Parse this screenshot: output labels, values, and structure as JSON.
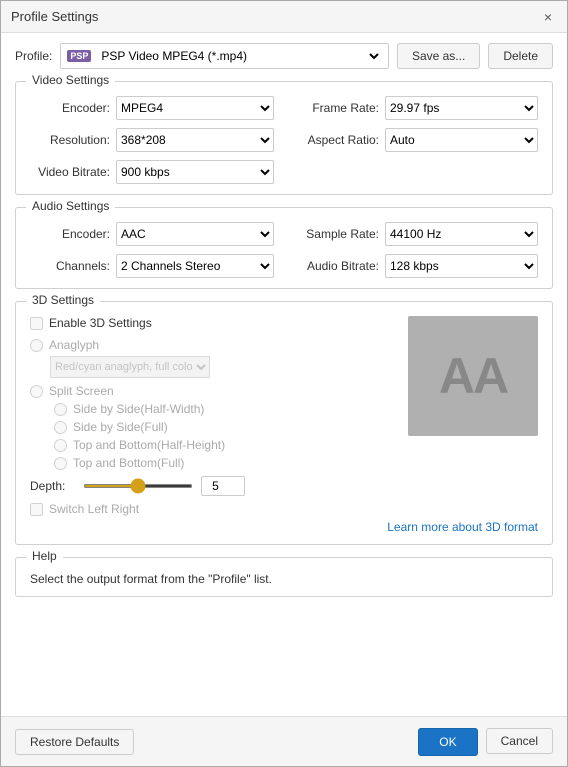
{
  "titleBar": {
    "title": "Profile Settings",
    "closeLabel": "×"
  },
  "profileRow": {
    "label": "Profile:",
    "badge": "PSP",
    "selectedProfile": "PSP Video MPEG4 (*.mp4)",
    "saveAsLabel": "Save as...",
    "deleteLabel": "Delete"
  },
  "videoSettings": {
    "sectionTitle": "Video Settings",
    "encoderLabel": "Encoder:",
    "encoderValue": "MPEG4",
    "resolutionLabel": "Resolution:",
    "resolutionValue": "368*208",
    "videoBitrateLabel": "Video Bitrate:",
    "videoBitrateValue": "900 kbps",
    "frameRateLabel": "Frame Rate:",
    "frameRateValue": "29.97 fps",
    "aspectRatioLabel": "Aspect Ratio:",
    "aspectRatioValue": "Auto"
  },
  "audioSettings": {
    "sectionTitle": "Audio Settings",
    "encoderLabel": "Encoder:",
    "encoderValue": "AAC",
    "channelsLabel": "Channels:",
    "channelsValue": "2 Channels Stereo",
    "sampleRateLabel": "Sample Rate:",
    "sampleRateValue": "44100 Hz",
    "audioBitrateLabel": "Audio Bitrate:",
    "audioBitrateValue": "128 kbps"
  },
  "d3Settings": {
    "sectionTitle": "3D Settings",
    "enableLabel": "Enable 3D Settings",
    "anaglyphLabel": "Anaglyph",
    "anaglyphSelectValue": "Red/cyan anaglyph, full color",
    "splitScreenLabel": "Split Screen",
    "option1": "Side by Side(Half-Width)",
    "option2": "Side by Side(Full)",
    "option3": "Top and Bottom(Half-Height)",
    "option4": "Top and Bottom(Full)",
    "depthLabel": "Depth:",
    "depthValue": "5",
    "switchLeftRightLabel": "Switch Left Right",
    "learnLink": "Learn more about 3D format",
    "previewAA": "AA"
  },
  "helpSection": {
    "sectionTitle": "Help",
    "helpText": "Select the output format from the \"Profile\" list."
  },
  "bottomBar": {
    "restoreDefaultsLabel": "Restore Defaults",
    "okLabel": "OK",
    "cancelLabel": "Cancel"
  }
}
